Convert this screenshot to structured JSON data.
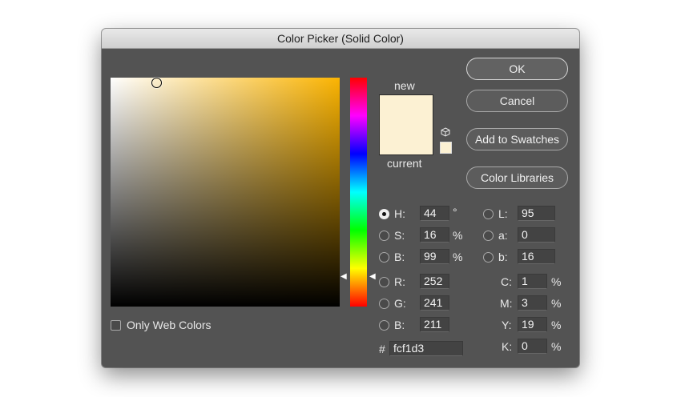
{
  "dialog": {
    "title": "Color Picker (Solid Color)"
  },
  "preview": {
    "new_label": "new",
    "current_label": "current",
    "new_color": "#fcf1d3",
    "current_color": "#fcf1d3"
  },
  "buttons": {
    "ok": "OK",
    "cancel": "Cancel",
    "add_swatches": "Add to Swatches",
    "libraries": "Color Libraries"
  },
  "web_colors": {
    "label": "Only Web Colors",
    "checked": false
  },
  "hsb": {
    "h": {
      "label": "H:",
      "value": "44",
      "unit": "°",
      "selected": true
    },
    "s": {
      "label": "S:",
      "value": "16",
      "unit": "%",
      "selected": false
    },
    "b": {
      "label": "B:",
      "value": "99",
      "unit": "%",
      "selected": false
    }
  },
  "rgb": {
    "r": {
      "label": "R:",
      "value": "252"
    },
    "g": {
      "label": "G:",
      "value": "241"
    },
    "b": {
      "label": "B:",
      "value": "211"
    }
  },
  "lab": {
    "l": {
      "label": "L:",
      "value": "95"
    },
    "a": {
      "label": "a:",
      "value": "0"
    },
    "b": {
      "label": "b:",
      "value": "16"
    }
  },
  "cmyk": {
    "c": {
      "label": "C:",
      "value": "1",
      "unit": "%"
    },
    "m": {
      "label": "M:",
      "value": "3",
      "unit": "%"
    },
    "y": {
      "label": "Y:",
      "value": "19",
      "unit": "%"
    },
    "k": {
      "label": "K:",
      "value": "0",
      "unit": "%"
    }
  },
  "hex": {
    "label": "#",
    "value": "fcf1d3"
  },
  "hue_base_color": "#fbb402"
}
